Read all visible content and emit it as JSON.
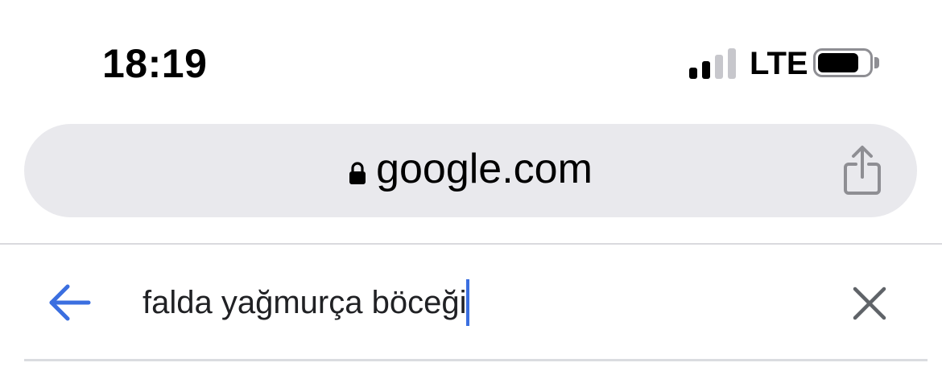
{
  "status_bar": {
    "time": "18:19",
    "network": "LTE",
    "signal_bars_active": 2,
    "signal_bars_total": 4,
    "battery_level": 0.8
  },
  "address_bar": {
    "url": "google.com",
    "lock_icon": "lock-icon",
    "share_icon": "share-icon"
  },
  "search": {
    "query": "falda yağmurça böceği",
    "back_icon": "arrow-left-icon",
    "clear_icon": "close-icon"
  },
  "colors": {
    "accent": "#3b6fe0",
    "address_bg": "#e9e9ed",
    "icon_gray": "#8e8e93",
    "text": "#202124"
  }
}
